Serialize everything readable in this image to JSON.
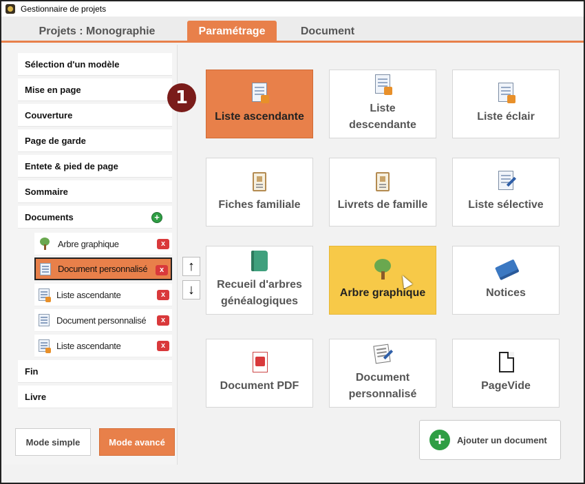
{
  "window": {
    "title": "Gestionnaire de projets"
  },
  "tabs": [
    {
      "label": "Projets : Monographie",
      "active": false
    },
    {
      "label": "Paramétrage",
      "active": true
    },
    {
      "label": "Document",
      "active": false
    }
  ],
  "sidebar": {
    "items": [
      {
        "label": "Sélection d'un modèle"
      },
      {
        "label": "Mise en page"
      },
      {
        "label": "Couverture"
      },
      {
        "label": "Page de garde"
      },
      {
        "label": "Entete & pied de page"
      },
      {
        "label": "Sommaire"
      },
      {
        "label": "Documents"
      }
    ],
    "documents": [
      {
        "label": "Arbre graphique",
        "icon": "tree-icon",
        "selected": false
      },
      {
        "label": "Document personnalisé",
        "icon": "document-icon",
        "selected": true
      },
      {
        "label": "Liste ascendante",
        "icon": "document-icon",
        "selected": false
      },
      {
        "label": "Document personnalisé",
        "icon": "document-icon",
        "selected": false
      },
      {
        "label": "Liste ascendante",
        "icon": "document-icon",
        "selected": false
      }
    ],
    "bottom_items": [
      {
        "label": "Fin"
      },
      {
        "label": "Livre"
      }
    ],
    "delete_glyph": "x",
    "add_glyph": "+"
  },
  "move": {
    "up_glyph": "↑",
    "down_glyph": "↓"
  },
  "step_badge": "1",
  "tiles": [
    {
      "label": "Liste ascendante",
      "icon": "ascendant-list-icon",
      "state": "active"
    },
    {
      "label": "Liste descendante",
      "icon": "descendant-list-icon",
      "state": "normal"
    },
    {
      "label": "Liste éclair",
      "icon": "flash-list-icon",
      "state": "normal"
    },
    {
      "label": "Fiches familiale",
      "icon": "family-sheet-icon",
      "state": "normal"
    },
    {
      "label": "Livrets de famille",
      "icon": "family-booklet-icon",
      "state": "normal"
    },
    {
      "label": "Liste sélective",
      "icon": "selective-list-icon",
      "state": "normal"
    },
    {
      "label": "Recueil d'arbres généalogiques",
      "icon": "book-icon",
      "state": "normal"
    },
    {
      "label": "Arbre graphique",
      "icon": "tree-icon",
      "state": "hover"
    },
    {
      "label": "Notices",
      "icon": "books-icon",
      "state": "normal"
    },
    {
      "label": "Document PDF",
      "icon": "pdf-icon",
      "state": "normal"
    },
    {
      "label": "Document personnalisé",
      "icon": "custom-document-icon",
      "state": "normal"
    },
    {
      "label": "PageVide",
      "icon": "blank-page-icon",
      "state": "normal"
    }
  ],
  "add_document": {
    "label": "Ajouter un document",
    "icon": "plus-icon",
    "glyph": "+"
  },
  "modes": {
    "simple": "Mode simple",
    "advanced": "Mode avancé"
  },
  "colors": {
    "accent": "#e8804a",
    "hover": "#f7c948",
    "delete": "#d9393b",
    "add": "#2f9e44"
  }
}
